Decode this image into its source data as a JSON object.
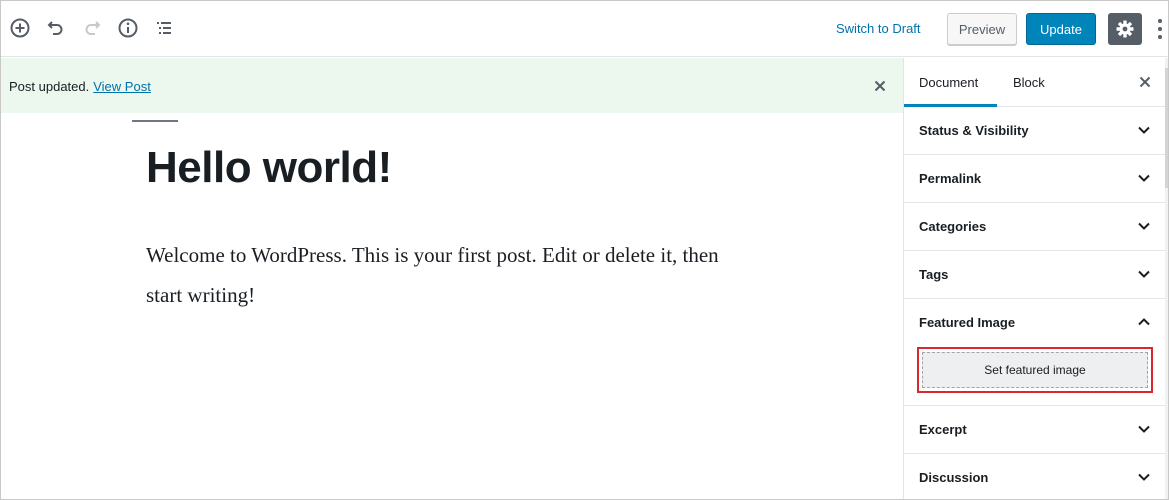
{
  "toolbar": {
    "switch_to_draft": "Switch to Draft",
    "preview_label": "Preview",
    "update_label": "Update",
    "icons": [
      "add-block-icon",
      "undo-icon",
      "redo-icon",
      "info-icon",
      "outline-icon",
      "gear-icon",
      "more-icon"
    ]
  },
  "notice": {
    "text": "Post updated.",
    "link": "View Post"
  },
  "post": {
    "title": "Hello world!",
    "content": "Welcome to WordPress. This is your first post. Edit or delete it, then start writing!"
  },
  "sidebar": {
    "tabs": [
      {
        "label": "Document",
        "active": true
      },
      {
        "label": "Block",
        "active": false
      }
    ],
    "panels": [
      {
        "label": "Status & Visibility",
        "open": false
      },
      {
        "label": "Permalink",
        "open": false
      },
      {
        "label": "Categories",
        "open": false
      },
      {
        "label": "Tags",
        "open": false
      },
      {
        "label": "Featured Image",
        "open": true
      },
      {
        "label": "Excerpt",
        "open": false
      },
      {
        "label": "Discussion",
        "open": false
      }
    ],
    "featured_button": "Set featured image"
  },
  "colors": {
    "accent": "#0085ba",
    "link": "#0073aa",
    "notice_bg": "#ecf7ed",
    "highlight": "#d9262f"
  }
}
